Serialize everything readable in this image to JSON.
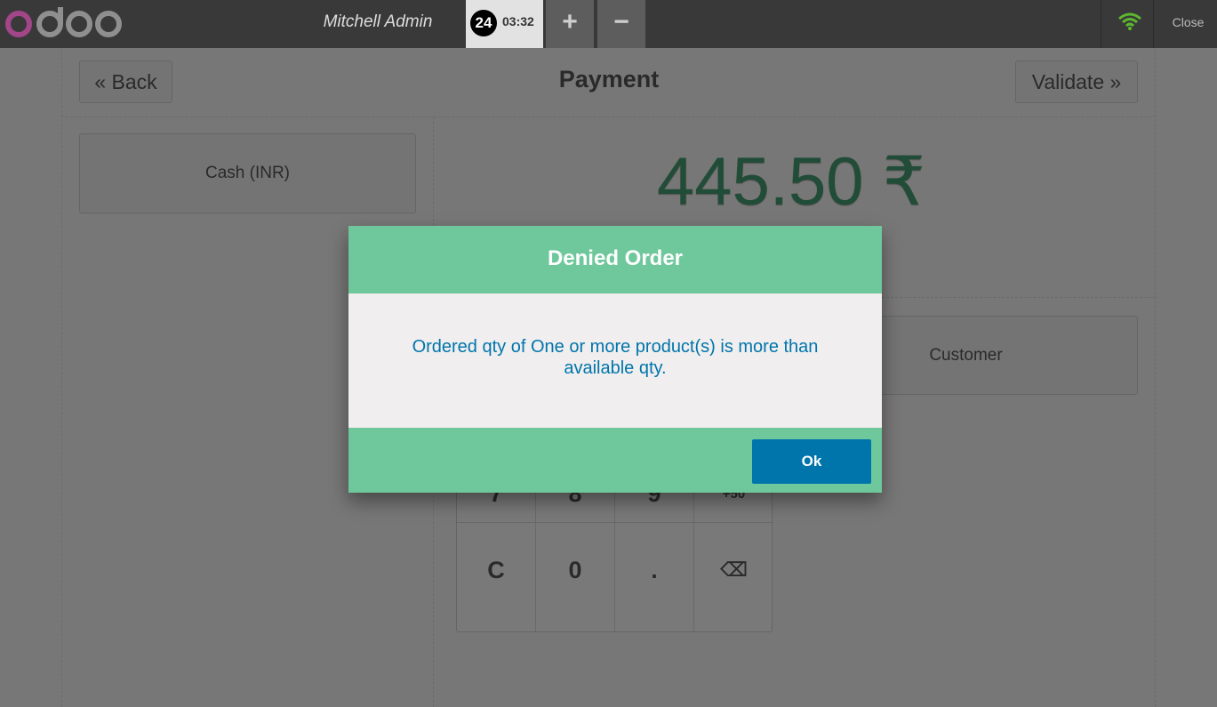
{
  "topbar": {
    "logo_text": "odoo",
    "cashier": "Mitchell Admin",
    "order": {
      "number": "24",
      "time": "03:32"
    },
    "add_order_label": "+",
    "remove_order_label": "−",
    "wifi_icon": "wifi-icon",
    "close_label": "Close"
  },
  "payment": {
    "back_label": "« Back",
    "title": "Payment",
    "validate_label": "Validate »",
    "method": "Cash (INR)",
    "total": "445.50 ₹",
    "customer_label": "Customer",
    "numpad": [
      [
        "7",
        "8",
        "9",
        "+50"
      ],
      [
        "C",
        "0",
        ".",
        "⌫"
      ]
    ]
  },
  "modal": {
    "title": "Denied Order",
    "message": "Ordered qty of One or more product(s) is more than available qty.",
    "ok_label": "Ok"
  },
  "colors": {
    "accent_green": "#6ec89b",
    "ok_blue": "#0075ac",
    "logo_purple": "#a24689",
    "topbar": "#393939"
  }
}
